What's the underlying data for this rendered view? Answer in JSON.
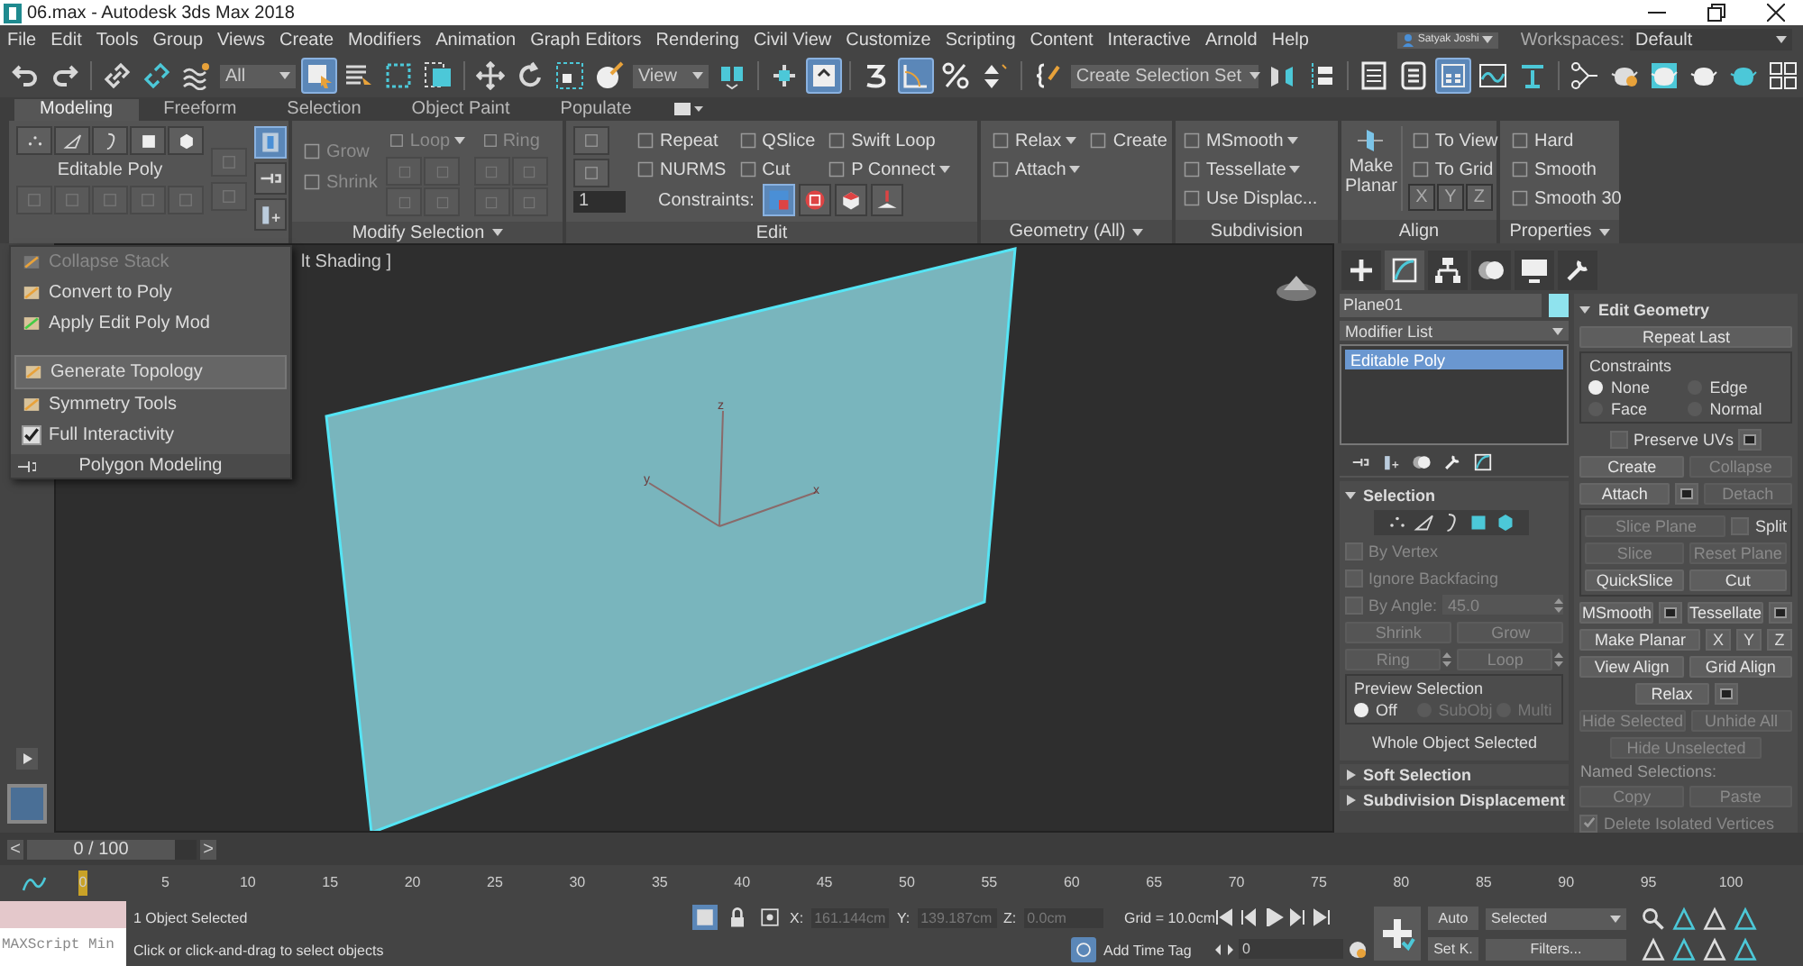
{
  "window": {
    "title": "06.max - Autodesk 3ds Max 2018"
  },
  "menu_bar": {
    "items": [
      "File",
      "Edit",
      "Tools",
      "Group",
      "Views",
      "Create",
      "Modifiers",
      "Animation",
      "Graph Editors",
      "Rendering",
      "Civil View",
      "Customize",
      "Scripting",
      "Content",
      "Interactive",
      "Arnold",
      "Help"
    ],
    "user": "Satyak Joshi",
    "workspaces_label": "Workspaces:",
    "workspace": "Default"
  },
  "toolbar": {
    "tools": [
      {
        "kind": "undo",
        "selected": false
      },
      {
        "kind": "redo",
        "selected": false
      },
      {
        "kind": "separator"
      },
      {
        "kind": "link",
        "selected": false
      },
      {
        "kind": "unlink",
        "selected": false
      },
      {
        "kind": "bind",
        "selected": false
      },
      {
        "kind": "dropdown",
        "value": "All"
      },
      {
        "kind": "select",
        "selected": true
      },
      {
        "kind": "select_by_name",
        "selected": false
      },
      {
        "kind": "rect_region",
        "selected": false
      },
      {
        "kind": "window_crossing",
        "selected": false
      },
      {
        "kind": "separator"
      },
      {
        "kind": "move",
        "selected": false
      },
      {
        "kind": "rotate",
        "selected": false
      },
      {
        "kind": "scale",
        "selected": false
      },
      {
        "kind": "placement",
        "selected": false
      },
      {
        "kind": "dropdown",
        "value": "View"
      },
      {
        "kind": "pivot",
        "selected": false
      },
      {
        "kind": "separator"
      },
      {
        "kind": "manipulate",
        "selected": false
      },
      {
        "kind": "keyboard",
        "selected": true
      },
      {
        "kind": "separator"
      },
      {
        "kind": "snap",
        "selected": false
      },
      {
        "kind": "angle_snap",
        "selected": true
      },
      {
        "kind": "percent_snap",
        "selected": false
      },
      {
        "kind": "spinner_snap",
        "selected": false
      },
      {
        "kind": "separator"
      },
      {
        "kind": "named_sel",
        "selected": false
      },
      {
        "kind": "dropdown",
        "value": "Create Selection Set"
      },
      {
        "kind": "mirror",
        "selected": false
      },
      {
        "kind": "align",
        "selected": false
      },
      {
        "kind": "separator"
      },
      {
        "kind": "scene_explorer",
        "selected": false
      },
      {
        "kind": "layer",
        "selected": false
      },
      {
        "kind": "ribbon",
        "selected": true
      },
      {
        "kind": "curve_editor",
        "selected": false
      },
      {
        "kind": "schematic",
        "selected": false
      },
      {
        "kind": "separator"
      },
      {
        "kind": "material",
        "selected": false
      },
      {
        "kind": "render_setup",
        "selected": false
      },
      {
        "kind": "render_frame",
        "selected": false
      },
      {
        "kind": "render",
        "selected": false
      },
      {
        "kind": "render_iterative",
        "selected": false
      },
      {
        "kind": "arnold",
        "selected": false
      }
    ]
  },
  "ribbon": {
    "tabs": [
      {
        "label": "Modeling",
        "selected": true
      },
      {
        "label": "Freeform",
        "selected": false
      },
      {
        "label": "Selection",
        "selected": false
      },
      {
        "label": "Object Paint",
        "selected": false
      },
      {
        "label": "Populate",
        "selected": false
      }
    ],
    "polygon_modeling": {
      "label": "Editable Poly",
      "side_tools": [
        {
          "kind": "modify_mode",
          "selected": true
        },
        {
          "kind": "pin",
          "selected": false
        },
        {
          "kind": "stack_tools",
          "selected": false
        }
      ]
    },
    "modify_selection": {
      "title": "Modify Selection",
      "items": [
        {
          "label": "Grow",
          "disabled": true
        },
        {
          "label": "Shrink",
          "disabled": true
        },
        {
          "label": "Loop",
          "disabled": true
        },
        {
          "label": "Ring",
          "disabled": true
        }
      ]
    },
    "edit": {
      "title": "Edit",
      "spinner": "1",
      "buttons": [
        {
          "label": "Repeat",
          "menu": false
        },
        {
          "label": "QSlice",
          "menu": false
        },
        {
          "label": "Swift Loop",
          "menu": false
        },
        {
          "label": "NURMS",
          "menu": false
        },
        {
          "label": "Cut",
          "menu": false
        },
        {
          "label": "P Connect",
          "menu": true
        }
      ],
      "constraints_label": "Constraints:",
      "constraints": [
        {
          "kind": "none",
          "selected": true
        },
        {
          "kind": "edge",
          "selected": false
        },
        {
          "kind": "face",
          "selected": false
        },
        {
          "kind": "normal",
          "selected": false
        }
      ]
    },
    "geometry": {
      "title": "Geometry (All)",
      "buttons": [
        {
          "label": "Relax",
          "menu": true
        },
        {
          "label": "Create",
          "menu": false
        },
        {
          "label": "Attach",
          "menu": true
        }
      ]
    },
    "subdivision": {
      "title": "Subdivision",
      "buttons": [
        {
          "label": "MSmooth",
          "menu": true
        },
        {
          "label": "Tessellate",
          "menu": true
        },
        {
          "label": "Use Displac...",
          "menu": false
        }
      ]
    },
    "align": {
      "title": "Align",
      "make_planar": "Make Planar",
      "buttons": [
        "To View",
        "To Grid"
      ],
      "axes": [
        "X",
        "Y",
        "Z"
      ]
    },
    "properties": {
      "title": "Properties",
      "buttons": [
        "Hard",
        "Smooth",
        "Smooth 30"
      ]
    }
  },
  "panel_menu": {
    "items": [
      {
        "kind": "command",
        "label": "Collapse Stack",
        "disabled": true,
        "selected": false
      },
      {
        "kind": "command",
        "label": "Convert to Poly",
        "disabled": false,
        "selected": false
      },
      {
        "kind": "command",
        "label": "Apply Edit Poly Mod",
        "disabled": false,
        "selected": false
      },
      {
        "kind": "spacer"
      },
      {
        "kind": "command",
        "label": "Generate Topology",
        "disabled": false,
        "selected": true
      },
      {
        "kind": "command",
        "label": "Symmetry Tools",
        "disabled": false,
        "selected": false
      },
      {
        "kind": "checkbox",
        "label": "Full Interactivity",
        "checked": true
      }
    ],
    "footer": "Polygon Modeling"
  },
  "viewport": {
    "label": "lt Shading ]",
    "axes": [
      "x",
      "y",
      "z"
    ]
  },
  "command_panel": {
    "tabs": [
      {
        "kind": "create",
        "selected": false
      },
      {
        "kind": "modify",
        "selected": true
      },
      {
        "kind": "hierarchy",
        "selected": false
      },
      {
        "kind": "motion",
        "selected": false
      },
      {
        "kind": "display",
        "selected": false
      },
      {
        "kind": "utilities",
        "selected": false
      }
    ],
    "object_name": "Plane01",
    "modifier_list": "Modifier List",
    "stack": [
      {
        "label": "Editable Poly",
        "selected": true
      }
    ],
    "selection": {
      "title": "Selection",
      "items": [
        {
          "kind": "row",
          "controls": [
            {
              "kind": "checkbox",
              "label": "By Vertex",
              "checked": false,
              "disabled": true
            }
          ]
        },
        {
          "kind": "row",
          "controls": [
            {
              "kind": "checkbox",
              "label": "Ignore Backfacing",
              "checked": false,
              "disabled": true
            }
          ]
        },
        {
          "kind": "row",
          "controls": [
            {
              "kind": "checkbox",
              "label": "By Angle:",
              "checked": false,
              "disabled": true
            },
            {
              "kind": "spinner",
              "value": "45.0",
              "disabled": true
            }
          ]
        },
        {
          "kind": "row",
          "controls": [
            {
              "kind": "button",
              "label": "Shrink",
              "disabled": true
            },
            {
              "kind": "button",
              "label": "Grow",
              "disabled": true
            }
          ]
        },
        {
          "kind": "row",
          "controls": [
            {
              "kind": "spin_button",
              "label": "Ring",
              "disabled": true
            },
            {
              "kind": "spin_button",
              "label": "Loop",
              "disabled": true
            }
          ]
        },
        {
          "kind": "radio_group",
          "title": "Preview Selection",
          "options": [
            {
              "label": "Off",
              "selected": true,
              "disabled": false
            },
            {
              "label": "SubObj",
              "selected": false,
              "disabled": true
            },
            {
              "label": "Multi",
              "selected": false,
              "disabled": true
            }
          ]
        },
        {
          "kind": "note",
          "label": "Whole Object Selected"
        }
      ]
    },
    "collapsed_rollouts": [
      "Soft Selection",
      "Subdivision Displacement"
    ],
    "edit_geometry": {
      "title": "Edit Geometry",
      "items": [
        {
          "kind": "row",
          "controls": [
            {
              "kind": "button",
              "label": "Repeat Last",
              "disabled": false
            }
          ]
        },
        {
          "kind": "radio_group",
          "title": "Constraints",
          "options": [
            {
              "label": "None",
              "selected": true,
              "disabled": false
            },
            {
              "label": "Edge",
              "selected": false,
              "disabled": false
            },
            {
              "label": "Face",
              "selected": false,
              "disabled": false
            },
            {
              "label": "Normal",
              "selected": false,
              "disabled": false
            }
          ]
        },
        {
          "kind": "row",
          "centered": true,
          "controls": [
            {
              "kind": "checkbox",
              "label": "Preserve UVs",
              "checked": false,
              "disabled": false
            },
            {
              "kind": "settings"
            }
          ]
        },
        {
          "kind": "row",
          "controls": [
            {
              "kind": "button",
              "label": "Create",
              "disabled": false
            },
            {
              "kind": "button",
              "label": "Collapse",
              "disabled": true
            }
          ]
        },
        {
          "kind": "row",
          "controls": [
            {
              "kind": "button",
              "label": "Attach",
              "disabled": false
            },
            {
              "kind": "settings"
            },
            {
              "kind": "button",
              "label": "Detach",
              "disabled": true
            }
          ]
        },
        {
          "kind": "group",
          "rows": [
            [
              {
                "kind": "button",
                "label": "Slice Plane",
                "disabled": true
              },
              {
                "kind": "checkbox",
                "label": "Split",
                "checked": false,
                "disabled": false
              }
            ],
            [
              {
                "kind": "button",
                "label": "Slice",
                "disabled": true
              },
              {
                "kind": "button",
                "label": "Reset Plane",
                "disabled": true
              }
            ],
            [
              {
                "kind": "button",
                "label": "QuickSlice",
                "disabled": false
              },
              {
                "kind": "button",
                "label": "Cut",
                "disabled": false
              }
            ]
          ]
        },
        {
          "kind": "row",
          "controls": [
            {
              "kind": "button",
              "label": "MSmooth",
              "disabled": false
            },
            {
              "kind": "settings"
            },
            {
              "kind": "button",
              "label": "Tessellate",
              "disabled": false
            },
            {
              "kind": "settings"
            }
          ]
        },
        {
          "kind": "row",
          "controls": [
            {
              "kind": "button",
              "label": "Make Planar",
              "disabled": false
            },
            {
              "kind": "small",
              "label": "X"
            },
            {
              "kind": "small",
              "label": "Y"
            },
            {
              "kind": "small",
              "label": "Z"
            }
          ]
        },
        {
          "kind": "row",
          "controls": [
            {
              "kind": "button",
              "label": "View Align",
              "disabled": false
            },
            {
              "kind": "button",
              "label": "Grid Align",
              "disabled": false
            }
          ]
        },
        {
          "kind": "row",
          "centered": true,
          "controls": [
            {
              "kind": "button",
              "label": "Relax",
              "disabled": false
            },
            {
              "kind": "settings"
            }
          ]
        },
        {
          "kind": "row",
          "controls": [
            {
              "kind": "button",
              "label": "Hide Selected",
              "disabled": true
            },
            {
              "kind": "button",
              "label": "Unhide All",
              "disabled": true
            }
          ]
        },
        {
          "kind": "row",
          "centered": true,
          "controls": [
            {
              "kind": "button",
              "label": "Hide Unselected",
              "disabled": true
            }
          ]
        },
        {
          "kind": "label",
          "label": "Named Selections:",
          "disabled": true
        },
        {
          "kind": "row",
          "controls": [
            {
              "kind": "button",
              "label": "Copy",
              "disabled": true
            },
            {
              "kind": "button",
              "label": "Paste",
              "disabled": true
            }
          ]
        },
        {
          "kind": "row",
          "controls": [
            {
              "kind": "checkbox",
              "label": "Delete Isolated Vertices",
              "checked": true,
              "disabled": true
            }
          ]
        }
      ]
    }
  },
  "timeline": {
    "prev": "<",
    "frame": "0 / 100",
    "level": 0,
    "next": ">",
    "ticks": [
      "0",
      "5",
      "10",
      "15",
      "20",
      "25",
      "30",
      "35",
      "40",
      "45",
      "50",
      "55",
      "60",
      "65",
      "70",
      "75",
      "80",
      "85",
      "90",
      "95",
      "100"
    ]
  },
  "status_bar": {
    "listener": "MAXScript Min",
    "selection": "1 Object Selected",
    "prompt": "Click or click-and-drag to select objects",
    "coords": [
      {
        "label": "X:",
        "value": "161.144cm"
      },
      {
        "label": "Y:",
        "value": "139.187cm"
      },
      {
        "label": "Z:",
        "value": "0.0cm"
      }
    ],
    "grid": "Grid = 10.0cm",
    "time_tag": "Add Time Tag",
    "frame": "0",
    "auto_key": "Auto",
    "set_key": "Set K.",
    "key_filter": "Selected",
    "filters": "Filters..."
  }
}
